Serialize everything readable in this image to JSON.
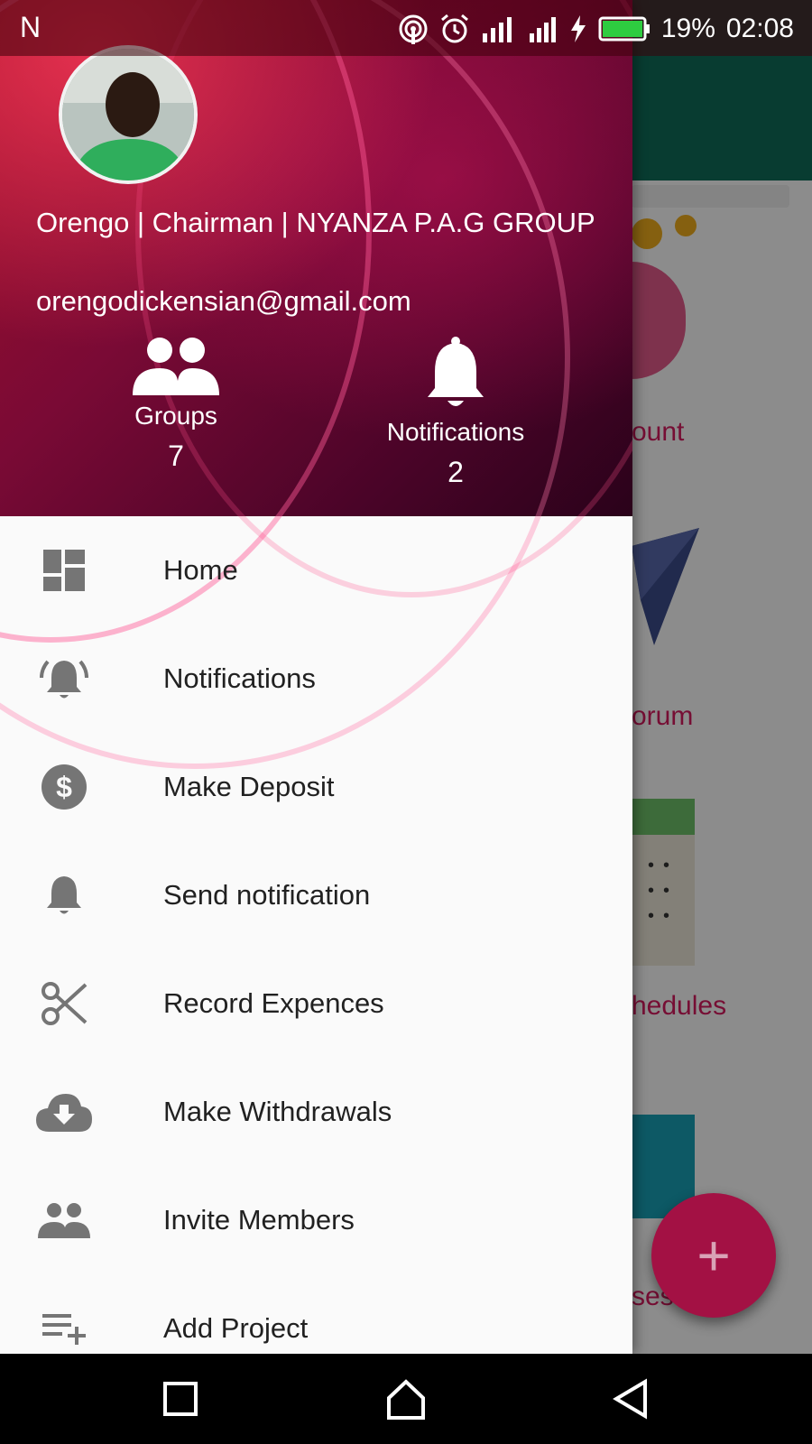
{
  "status_bar": {
    "left_label": "N",
    "battery": "19%",
    "time": "02:08",
    "icons": [
      "hotspot-icon",
      "alarm-icon",
      "signal-icon",
      "signal-icon",
      "charging-icon",
      "battery-icon"
    ]
  },
  "drawer": {
    "header": {
      "name": "Orengo | Chairman | NYANZA P.A.G GROUP",
      "email": "orengodickensian@gmail.com",
      "stats": [
        {
          "label": "Groups",
          "count": "7",
          "icon": "groups-icon"
        },
        {
          "label": "Notifications",
          "count": "2",
          "icon": "bell-icon"
        }
      ]
    },
    "menu": [
      {
        "label": "Home",
        "icon": "dashboard-icon"
      },
      {
        "label": "Notifications",
        "icon": "ringing-bell-icon"
      },
      {
        "label": "Make Deposit",
        "icon": "dollar-circle-icon"
      },
      {
        "label": "Send notification",
        "icon": "bell-icon"
      },
      {
        "label": "Record Expences",
        "icon": "scissors-icon"
      },
      {
        "label": "Make Withdrawals",
        "icon": "cloud-download-icon"
      },
      {
        "label": "Invite Members",
        "icon": "people-icon"
      },
      {
        "label": "Add Project",
        "icon": "playlist-add-icon"
      }
    ]
  },
  "background": {
    "labels": [
      "ount",
      "orum",
      "hedules",
      "ses"
    ],
    "fab_label": "+"
  },
  "colors": {
    "accent": "#d81b60",
    "appbar": "#0f6d5a",
    "header_dark": "#4a0428"
  }
}
